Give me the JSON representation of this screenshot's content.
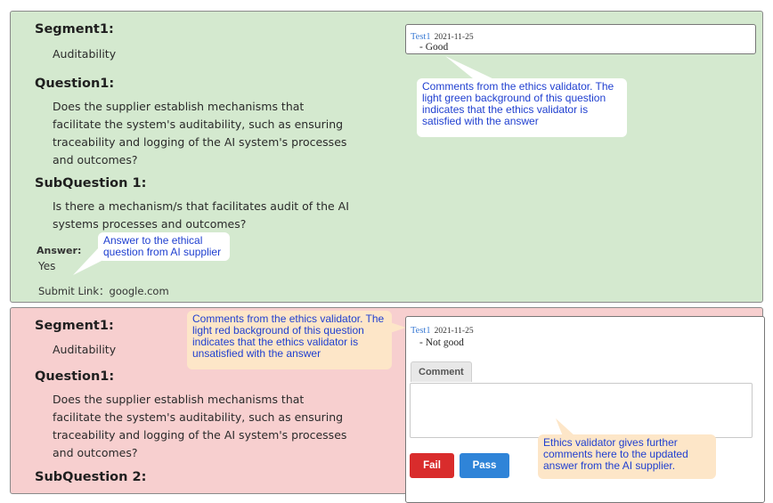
{
  "approved_item": {
    "segment_heading": "Segment1:",
    "segment_value": "Auditability",
    "question_heading": "Question1:",
    "question_text": "Does the supplier establish mechanisms that facilitate the system's auditability, such as ensuring traceability and logging of the AI system's processes and outcomes?",
    "subquestion_heading": "SubQuestion 1:",
    "subquestion_text": "Is there a mechanism/s that facilitates audit of the AI systems processes and outcomes?",
    "answer_label": "Answer:",
    "answer_value": "Yes",
    "submit_link_label": "Submit Link：",
    "submit_link_value": "google.com",
    "comment": {
      "author": "Test1",
      "date": "2021-11-25",
      "text": "- Good"
    },
    "callout_comment": "Comments from the ethics validator. The light green background of this question indicates that the ethics validator is satisfied with the answer",
    "callout_answer": "Answer to the ethical question from AI supplier",
    "background_color": "#d4e9cf"
  },
  "rejected_item": {
    "segment_heading": "Segment1:",
    "segment_value": "Auditability",
    "question_heading": "Question1:",
    "question_text": "Does the supplier establish mechanisms that facilitate the system's auditability, such as ensuring traceability and logging of the AI system's processes and outcomes?",
    "subquestion_heading": "SubQuestion 2:",
    "comment": {
      "author": "Test1",
      "date": "2021-11-25",
      "text": "- Not good"
    },
    "comment_tab_label": "Comment",
    "comment_input_value": "",
    "fail_button_label": "Fail",
    "pass_button_label": "Pass",
    "callout_comment": "Comments from the ethics validator. The light red background of this question indicates that the ethics validator is unsatisfied with the answer",
    "callout_further": "Ethics validator gives further comments here to the updated answer from the AI supplier.",
    "background_color": "#f7cfcf"
  },
  "colors": {
    "fail": "#d92c2c",
    "pass": "#2f84d8",
    "callout_text": "#1f3fd0",
    "author_link": "#3b7bd4"
  }
}
